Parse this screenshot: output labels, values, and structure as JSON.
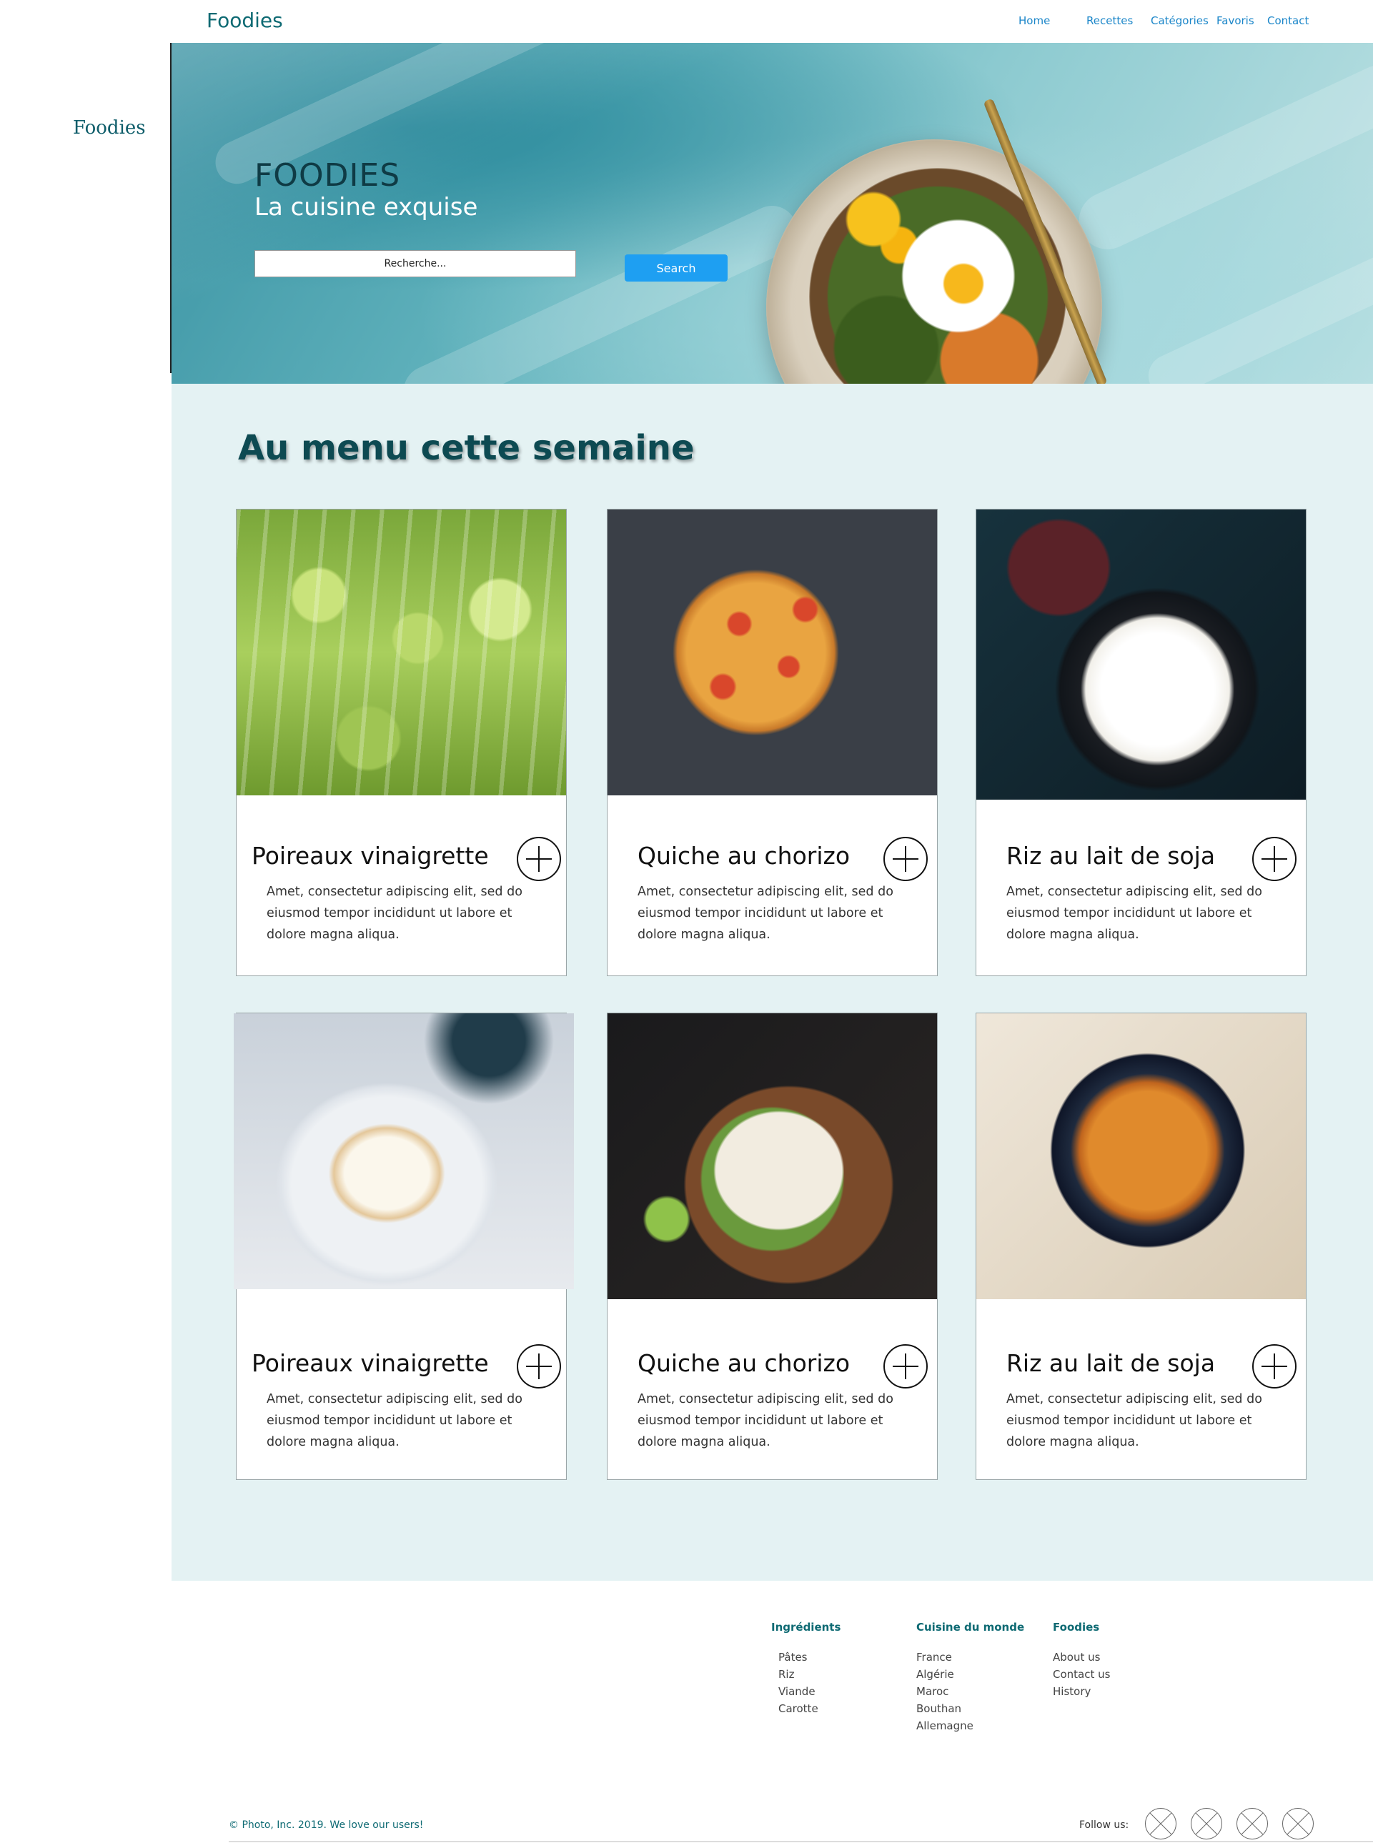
{
  "nav": {
    "brand": "Foodies",
    "links": [
      "Home",
      "Recettes",
      "Catégories",
      "Favoris",
      "Contact"
    ]
  },
  "sidebar": {
    "brand": "Foodies"
  },
  "hero": {
    "title": "FOODIES",
    "subtitle": "La cuisine exquise",
    "search_placeholder": "Recherche...",
    "search_button": "Search"
  },
  "menu": {
    "heading": "Au menu cette semaine",
    "cards": [
      {
        "title": "Poireaux vinaigrette",
        "description": "Amet, consectetur adipiscing elit, sed do eiusmod tempor incididunt ut labore et dolore magna aliqua."
      },
      {
        "title": "Quiche au chorizo",
        "description": "Amet, consectetur adipiscing elit, sed do eiusmod tempor incididunt ut labore et dolore magna aliqua."
      },
      {
        "title": "Riz au lait de soja",
        "description": "Amet, consectetur adipiscing elit, sed do eiusmod tempor incididunt ut labore et dolore magna aliqua."
      },
      {
        "title": "Poireaux vinaigrette",
        "description": "Amet, consectetur adipiscing elit, sed do eiusmod tempor incididunt ut labore et dolore magna aliqua."
      },
      {
        "title": "Quiche au chorizo",
        "description": "Amet, consectetur adipiscing elit, sed do eiusmod tempor incididunt ut labore et dolore magna aliqua."
      },
      {
        "title": "Riz au lait de soja",
        "description": "Amet, consectetur adipiscing elit, sed do eiusmod tempor incididunt ut labore et dolore magna aliqua."
      }
    ]
  },
  "footer": {
    "columns": [
      {
        "heading": "Ingrédients",
        "links": [
          "Pâtes",
          "Riz",
          "Viande",
          "Carotte"
        ]
      },
      {
        "heading": "Cuisine du monde",
        "links": [
          "France",
          "Algérie",
          "Maroc",
          "Bouthan",
          "Allemagne"
        ]
      },
      {
        "heading": "Foodies",
        "links": [
          "About us",
          "Contact us",
          "History"
        ]
      }
    ],
    "copyright": "© Photo, Inc. 2019. We love our users!",
    "follow_label": "Follow us:"
  },
  "colors": {
    "brand": "#0e6a73",
    "link": "#1b86c9",
    "search_button": "#1e9ff2",
    "section_bg": "#e4f2f3"
  }
}
